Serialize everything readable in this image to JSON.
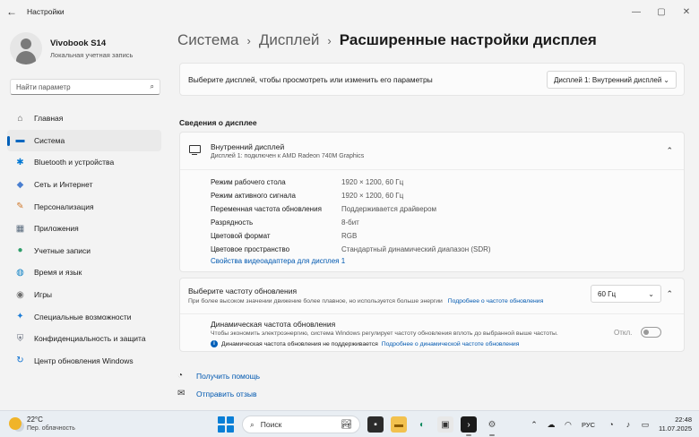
{
  "window": {
    "title": "Настройки",
    "controls": {
      "minimize": "—",
      "maximize": "▢",
      "close": "✕"
    }
  },
  "profile": {
    "name": "Vivobook S14",
    "account_type": "Локальная учетная запись"
  },
  "search": {
    "placeholder": "Найти параметр"
  },
  "nav": [
    {
      "label": "Главная",
      "icon": "home-icon",
      "glyph": "⌂",
      "color": "#555555"
    },
    {
      "label": "Система",
      "icon": "system-icon",
      "glyph": "▬",
      "color": "#0067c0",
      "active": true
    },
    {
      "label": "Bluetooth и устройства",
      "icon": "bluetooth-icon",
      "glyph": "✱",
      "color": "#0078d4"
    },
    {
      "label": "Сеть и Интернет",
      "icon": "network-icon",
      "glyph": "◆",
      "color": "#4a7fd0"
    },
    {
      "label": "Персонализация",
      "icon": "personalization-icon",
      "glyph": "✎",
      "color": "#d07a2d"
    },
    {
      "label": "Приложения",
      "icon": "apps-icon",
      "glyph": "▦",
      "color": "#5a6b7d"
    },
    {
      "label": "Учетные записи",
      "icon": "accounts-icon",
      "glyph": "●",
      "color": "#2e9e6a"
    },
    {
      "label": "Время и язык",
      "icon": "time-language-icon",
      "glyph": "◍",
      "color": "#0a7fc4"
    },
    {
      "label": "Игры",
      "icon": "gaming-icon",
      "glyph": "◉",
      "color": "#6d6d6d"
    },
    {
      "label": "Специальные возможности",
      "icon": "accessibility-icon",
      "glyph": "✦",
      "color": "#1c7cd6"
    },
    {
      "label": "Конфиденциальность и защита",
      "icon": "privacy-icon",
      "glyph": "⛨",
      "color": "#6b7280"
    },
    {
      "label": "Центр обновления Windows",
      "icon": "windows-update-icon",
      "glyph": "↻",
      "color": "#0a6fd0"
    }
  ],
  "breadcrumb": {
    "level1": "Система",
    "level2": "Дисплей",
    "separator": "›",
    "current": "Расширенные настройки дисплея"
  },
  "display_select": {
    "label": "Выберите дисплей, чтобы просмотреть или изменить его параметры",
    "value": "Дисплей 1: Внутренний дисплей"
  },
  "display_info": {
    "section_title": "Сведения о дисплее",
    "title": "Внутренний дисплей",
    "subtitle": "Дисплей 1: подключен к AMD Radeon 740M Graphics",
    "properties": [
      {
        "key": "Режим рабочего стола",
        "value": "1920 × 1200, 60 Гц"
      },
      {
        "key": "Режим активного сигнала",
        "value": "1920 × 1200, 60 Гц"
      },
      {
        "key": "Переменная частота обновления",
        "value": "Поддерживается драйвером"
      },
      {
        "key": "Разрядность",
        "value": "8-бит"
      },
      {
        "key": "Цветовой формат",
        "value": "RGB"
      },
      {
        "key": "Цветовое пространство",
        "value": "Стандартный динамический диапазон (SDR)"
      }
    ],
    "adapter_link": "Свойства видеоадаптера для дисплея 1"
  },
  "refresh": {
    "title": "Выберите частоту обновления",
    "subtitle": "При более высоком значении движение более плавное, но используется больше энергии",
    "more_link": "Подробнее о частоте обновления",
    "value": "60 Гц",
    "dynamic": {
      "title": "Динамическая частота обновления",
      "subtitle": "Чтобы экономить электроэнергию, система Windows регулирует частоту обновления вплоть до выбранной выше частоты.",
      "note": "Динамическая частота обновления не поддерживается",
      "note_link": "Подробнее о динамической частоте обновления",
      "toggle_label": "Откл.",
      "enabled": false
    }
  },
  "help": {
    "get_help": "Получить помощь",
    "send_feedback": "Отправить отзыв"
  },
  "taskbar": {
    "weather_temp": "22°C",
    "weather_desc": "Пер. облачность",
    "search_label": "Поиск",
    "language": "РУС",
    "time": "22:48",
    "date": "11.07.2025",
    "colors": {
      "start": "#0a7fd6",
      "accent": "#005fb8"
    }
  }
}
